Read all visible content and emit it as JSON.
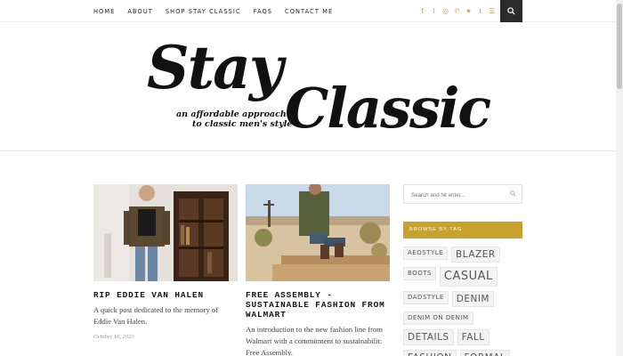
{
  "nav": {
    "items": [
      "HOME",
      "ABOUT",
      "SHOP STAY CLASSIC",
      "FAQS",
      "CONTACT ME"
    ]
  },
  "social": {
    "icons": [
      "facebook-icon",
      "twitter-icon",
      "instagram-icon",
      "pinterest-icon",
      "bloglovin-icon",
      "tumblr-icon",
      "rss-icon"
    ],
    "glyphs": [
      "f",
      "t",
      "◎",
      "℗",
      "♥",
      "t",
      "☰"
    ],
    "accent": "#c9a44a"
  },
  "logo": {
    "word1": "Stay",
    "word2": "Classic",
    "tagline1": "an affordable approach",
    "tagline2": "to classic men's style"
  },
  "posts": [
    {
      "title": "RIP EDDIE VAN HALEN",
      "excerpt": "A quick post dedicated to the memory of Eddie Van Halen.",
      "date": "October 16, 2020"
    },
    {
      "title": "FREE ASSEMBLY - SUSTAINABLE FASHION FROM WALMART",
      "excerpt": "An introduction to the new fashion line from Walmart with a commitment to sustainabilit: Free Assembly.",
      "date": ""
    }
  ],
  "sidebar": {
    "search_placeholder": "Search and hit enter...",
    "tags_heading": "BROWSE BY TAG",
    "tags": [
      {
        "label": "AEOSTYLE",
        "size": "small"
      },
      {
        "label": "BLAZER",
        "size": "medium"
      },
      {
        "label": "BOOTS",
        "size": "small"
      },
      {
        "label": "CASUAL",
        "size": "large"
      },
      {
        "label": "DADSTYLE",
        "size": "small"
      },
      {
        "label": "DENIM",
        "size": "medium"
      },
      {
        "label": "DENIM ON DENIM",
        "size": "small"
      },
      {
        "label": "DETAILS",
        "size": "medium"
      },
      {
        "label": "FALL",
        "size": "medium"
      },
      {
        "label": "FASHION",
        "size": "medium"
      },
      {
        "label": "FORMAL",
        "size": "medium"
      }
    ],
    "accent": "#c9a22e"
  }
}
